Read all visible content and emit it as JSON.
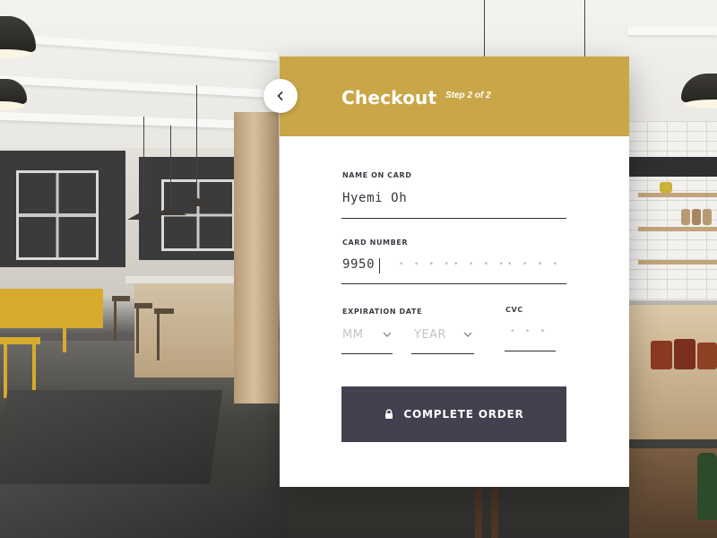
{
  "checkout": {
    "title": "Checkout",
    "step": "Step 2 of 2",
    "accent_color": "#c9a647",
    "button_color": "#414150",
    "back_icon": "chevron-left-icon"
  },
  "form": {
    "name_on_card": {
      "label": "NAME ON CARD",
      "value": "Hyemi Oh"
    },
    "card_number": {
      "label": "CARD NUMBER",
      "value": "9950",
      "masked_groups": [
        "• • • •",
        "• • • •",
        "• • • •"
      ]
    },
    "expiration_date": {
      "label": "EXPIRATION DATE",
      "month_placeholder": "MM",
      "year_placeholder": "YEAR"
    },
    "cvc": {
      "label": "CVC",
      "placeholder": "• • •"
    }
  },
  "submit": {
    "label": "COMPLETE ORDER",
    "icon": "lock-icon"
  }
}
